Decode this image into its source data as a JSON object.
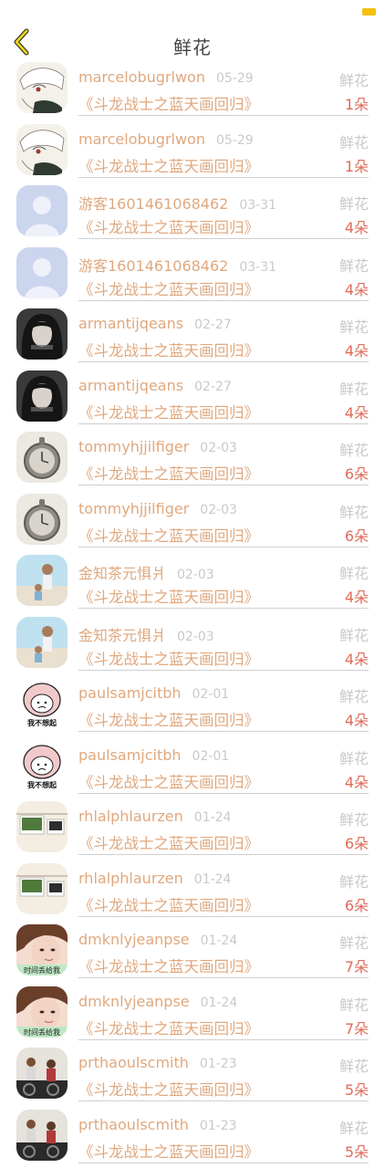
{
  "header": {
    "title": "鲜花"
  },
  "colors": {
    "accent": "#e0a87e",
    "count": "#e06b5a",
    "muted": "#c9c9c9"
  },
  "rows": [
    {
      "avatar": "anime-sketch",
      "name": "marcelobugrlwon",
      "date": "05-29",
      "book": "《斗龙战士之蓝天画回归》",
      "gift": "鲜花",
      "count": "1朵"
    },
    {
      "avatar": "anime-sketch",
      "name": "marcelobugrlwon",
      "date": "05-29",
      "book": "《斗龙战士之蓝天画回归》",
      "gift": "鲜花",
      "count": "1朵"
    },
    {
      "avatar": "default",
      "name": "游客1601461068462",
      "date": "03-31",
      "book": "《斗龙战士之蓝天画回归》",
      "gift": "鲜花",
      "count": "4朵"
    },
    {
      "avatar": "default",
      "name": "游客1601461068462",
      "date": "03-31",
      "book": "《斗龙战士之蓝天画回归》",
      "gift": "鲜花",
      "count": "4朵"
    },
    {
      "avatar": "girl-dark",
      "name": "armantijqeans",
      "date": "02-27",
      "book": "《斗龙战士之蓝天画回归》",
      "gift": "鲜花",
      "count": "4朵"
    },
    {
      "avatar": "girl-dark",
      "name": "armantijqeans",
      "date": "02-27",
      "book": "《斗龙战士之蓝天画回归》",
      "gift": "鲜花",
      "count": "4朵"
    },
    {
      "avatar": "pocket-watch",
      "name": "tommyhjjilfiger",
      "date": "02-03",
      "book": "《斗龙战士之蓝天画回归》",
      "gift": "鲜花",
      "count": "6朵"
    },
    {
      "avatar": "pocket-watch",
      "name": "tommyhjjilfiger",
      "date": "02-03",
      "book": "《斗龙战士之蓝天画回归》",
      "gift": "鲜花",
      "count": "6朵"
    },
    {
      "avatar": "beach",
      "name": "金知茶元惧爿",
      "date": "02-03",
      "book": "《斗龙战士之蓝天画回归》",
      "gift": "鲜花",
      "count": "4朵"
    },
    {
      "avatar": "beach",
      "name": "金知茶元惧爿",
      "date": "02-03",
      "book": "《斗龙战士之蓝天画回归》",
      "gift": "鲜花",
      "count": "4朵"
    },
    {
      "avatar": "cartoon",
      "name": "paulsamjcitbh",
      "date": "02-01",
      "book": "《斗龙战士之蓝天画回归》",
      "gift": "鲜花",
      "count": "4朵",
      "avatar_caption": "我不想起"
    },
    {
      "avatar": "cartoon",
      "name": "paulsamjcitbh",
      "date": "02-01",
      "book": "《斗龙战士之蓝天画回归》",
      "gift": "鲜花",
      "count": "4朵",
      "avatar_caption": "我不想起"
    },
    {
      "avatar": "photos",
      "name": "rhlalphlaurzen",
      "date": "01-24",
      "book": "《斗龙战士之蓝天画回归》",
      "gift": "鲜花",
      "count": "6朵"
    },
    {
      "avatar": "photos",
      "name": "rhlalphlaurzen",
      "date": "01-24",
      "book": "《斗龙战士之蓝天画回归》",
      "gift": "鲜花",
      "count": "6朵"
    },
    {
      "avatar": "girl-face",
      "name": "dmknlyjeanpse",
      "date": "01-24",
      "book": "《斗龙战士之蓝天画回归》",
      "gift": "鲜花",
      "count": "7朵",
      "avatar_caption": "时间丢给我"
    },
    {
      "avatar": "girl-face",
      "name": "dmknlyjeanpse",
      "date": "01-24",
      "book": "《斗龙战士之蓝天画回归》",
      "gift": "鲜花",
      "count": "7朵",
      "avatar_caption": "时间丢给我"
    },
    {
      "avatar": "gym",
      "name": "prthaoulscmith",
      "date": "01-23",
      "book": "《斗龙战士之蓝天画回归》",
      "gift": "鲜花",
      "count": "5朵"
    },
    {
      "avatar": "gym",
      "name": "prthaoulscmith",
      "date": "01-23",
      "book": "《斗龙战士之蓝天画回归》",
      "gift": "鲜花",
      "count": "5朵"
    }
  ]
}
